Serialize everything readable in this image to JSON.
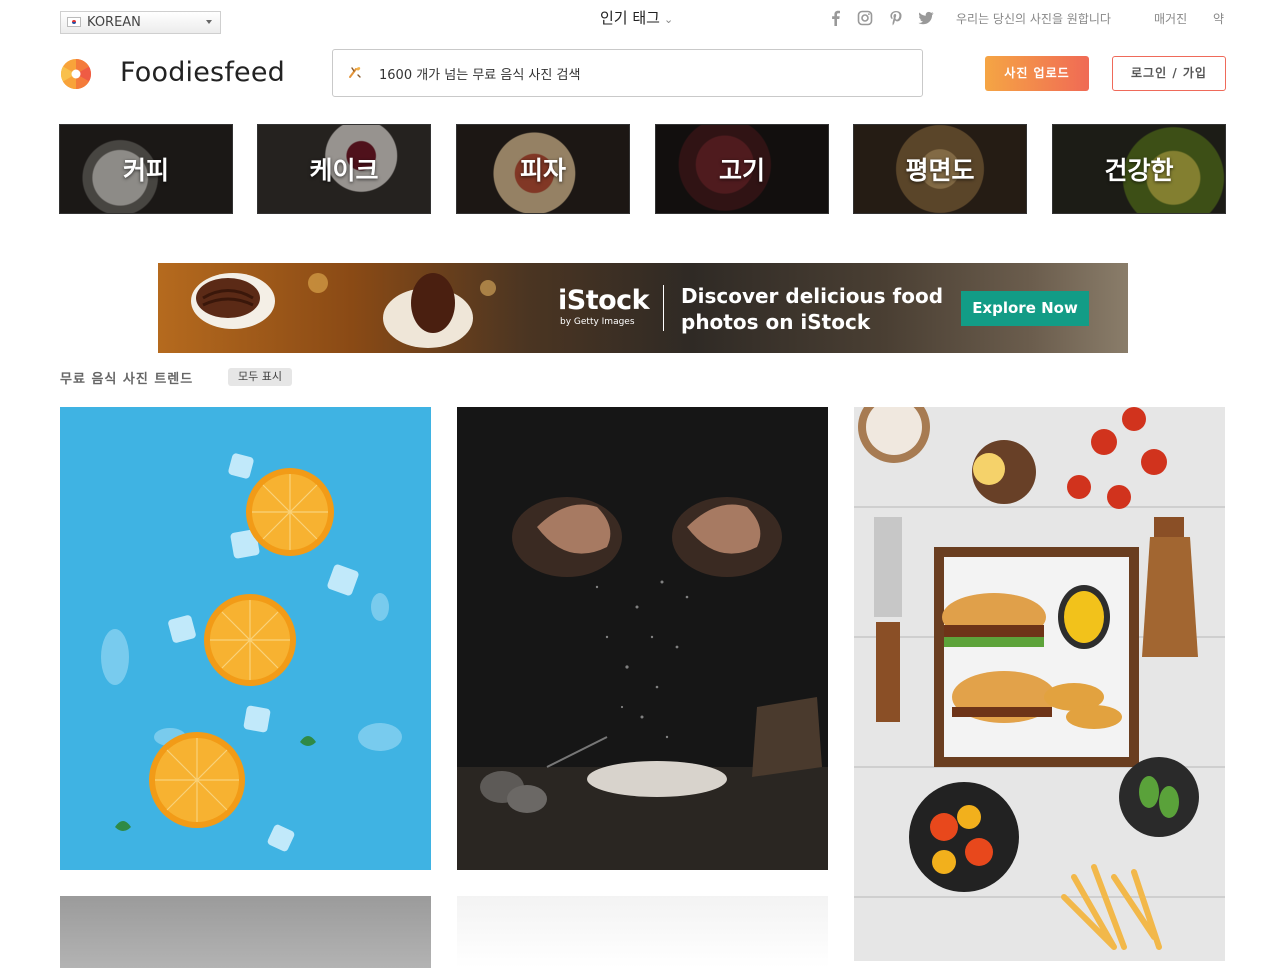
{
  "topbar": {
    "language": "KOREAN",
    "popular_tags": "인기 태그",
    "links": [
      "우리는 당신의 사진을 원합니다",
      "매거진",
      "약"
    ],
    "social_icons": [
      "facebook-icon",
      "instagram-icon",
      "pinterest-icon",
      "twitter-icon"
    ]
  },
  "header": {
    "brand": "Foodiesfeed",
    "search_placeholder": "1600 개가 넘는 무료 음식 사진 검색",
    "upload_label": "사진 업로드",
    "login_label": "로그인 / 가입"
  },
  "categories": [
    "커피",
    "케이크",
    "피자",
    "고기",
    "평면도",
    "건강한"
  ],
  "banner": {
    "logo": "iStock",
    "logo_sub": "by Getty Images",
    "headline": "Discover delicious food photos on iStock",
    "cta": "Explore Now"
  },
  "trending": {
    "title": "무료 음식 사진 트렌드",
    "show_all": "모두 표시"
  },
  "colors": {
    "accent_gradient_start": "#f5a544",
    "accent_gradient_end": "#f06a55",
    "banner_cta": "#129c86"
  }
}
